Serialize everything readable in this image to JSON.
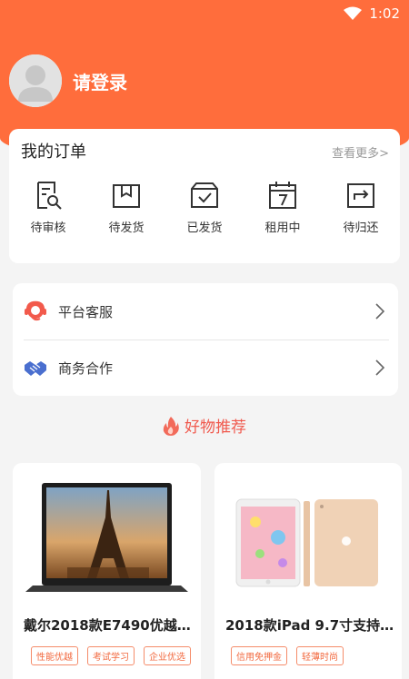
{
  "status": {
    "time": "1:02"
  },
  "profile": {
    "login_text": "请登录"
  },
  "orders": {
    "title": "我的订单",
    "more": "查看更多>",
    "items": [
      {
        "label": "待审核",
        "icon": "review-icon"
      },
      {
        "label": "待发货",
        "icon": "package-icon"
      },
      {
        "label": "已发货",
        "icon": "shipped-box-icon"
      },
      {
        "label": "租用中",
        "icon": "calendar-icon"
      },
      {
        "label": "待归还",
        "icon": "return-icon"
      }
    ]
  },
  "services": [
    {
      "label": "平台客服",
      "icon": "customer-service-icon"
    },
    {
      "label": "商务合作",
      "icon": "handshake-icon"
    }
  ],
  "recommend": {
    "title": "好物推荐"
  },
  "products": [
    {
      "name": "戴尔2018款E7490优越…",
      "tags": [
        "性能优越",
        "考试学习",
        "企业优选"
      ]
    },
    {
      "name": "2018款iPad 9.7寸支持…",
      "tags": [
        "信用免押金",
        "轻薄时尚"
      ]
    }
  ],
  "colors": {
    "accent": "#ff6d3c",
    "recommend": "#f05a4e"
  }
}
